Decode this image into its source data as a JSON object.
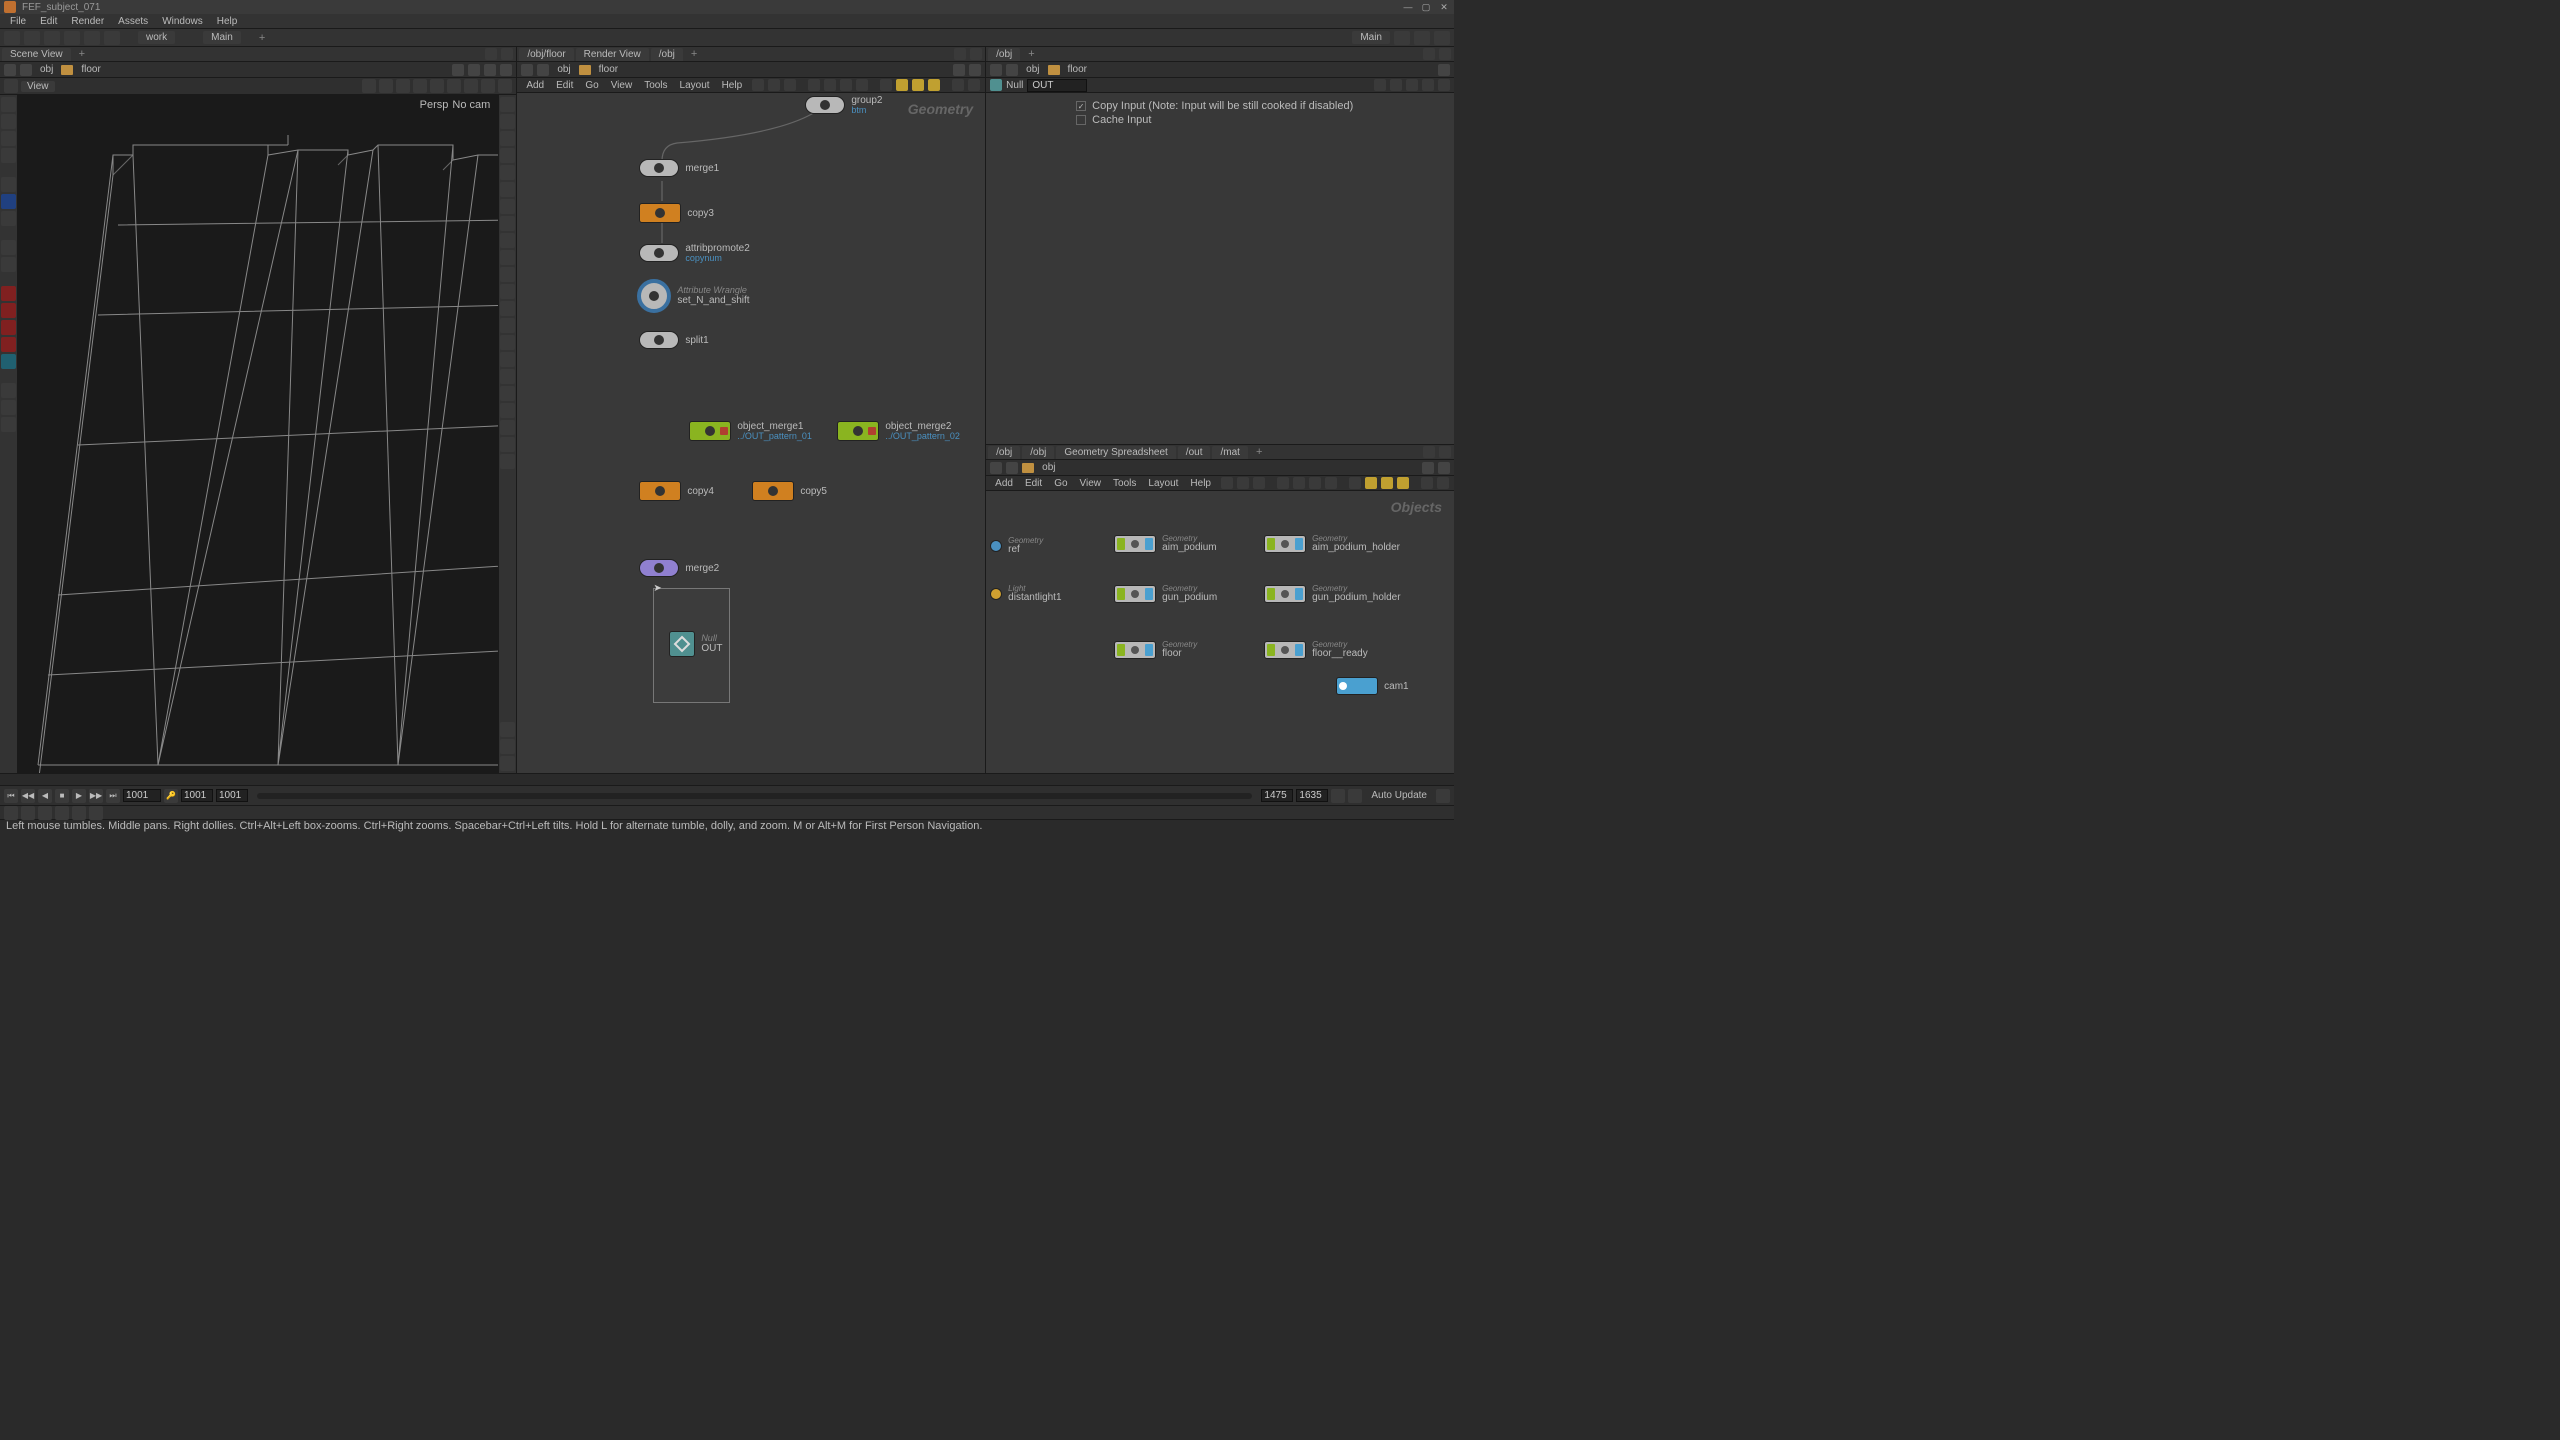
{
  "titlebar": {
    "title": "FEF_subject_071"
  },
  "menubar": [
    "File",
    "Edit",
    "Render",
    "Assets",
    "Windows",
    "Help"
  ],
  "shelf_tabs": [
    "work",
    "Main"
  ],
  "shelf_right": "Main",
  "viewport": {
    "tab": "Scene View",
    "path_prefix": "obj",
    "path": "floor",
    "toolbar_label": "View",
    "persp": "Persp",
    "cam": "No cam"
  },
  "network": {
    "tabs": [
      "/obj/floor",
      "Render View",
      "/obj"
    ],
    "path_prefix": "obj",
    "path": "floor",
    "menus": [
      "Add",
      "Edit",
      "Go",
      "View",
      "Tools",
      "Layout",
      "Help"
    ],
    "context": "Geometry",
    "nodes": {
      "group2": {
        "name": "group2",
        "sub": "btm"
      },
      "merge1": {
        "name": "merge1"
      },
      "copy3": {
        "name": "copy3"
      },
      "attribpromote2": {
        "name": "attribpromote2",
        "sub": "copynum"
      },
      "set_N_and_shift": {
        "name": "set_N_and_shift",
        "type": "Attribute Wrangle"
      },
      "split1": {
        "name": "split1"
      },
      "object_merge1": {
        "name": "object_merge1",
        "sub": "../OUT_pattern_01"
      },
      "object_merge2": {
        "name": "object_merge2",
        "sub": "../OUT_pattern_02"
      },
      "copy4": {
        "name": "copy4"
      },
      "copy5": {
        "name": "copy5"
      },
      "merge2": {
        "name": "merge2"
      },
      "out": {
        "name": "OUT",
        "type": "Null"
      }
    }
  },
  "params": {
    "tab": "/obj",
    "path_prefix": "obj",
    "path": "floor",
    "node_type": "Null",
    "node_name": "OUT",
    "copy_input": "Copy Input (Note: Input will be still cooked if disabled)",
    "cache_input": "Cache Input"
  },
  "objects": {
    "tabs": [
      "/obj",
      "/obj",
      "Geometry Spreadsheet",
      "/out",
      "/mat"
    ],
    "path": "obj",
    "menus": [
      "Add",
      "Edit",
      "Go",
      "View",
      "Tools",
      "Layout",
      "Help"
    ],
    "context": "Objects",
    "items": {
      "ref": {
        "name": "ref",
        "type": "Geometry"
      },
      "distantlight1": {
        "name": "distantlight1",
        "type": "Light"
      },
      "aim_podium": {
        "name": "aim_podium",
        "type": "Geometry"
      },
      "gun_podium": {
        "name": "gun_podium",
        "type": "Geometry"
      },
      "floor": {
        "name": "floor",
        "type": "Geometry"
      },
      "aim_podium_holder": {
        "name": "aim_podium_holder",
        "type": "Geometry"
      },
      "gun_podium_holder": {
        "name": "gun_podium_holder",
        "type": "Geometry"
      },
      "floor_ready": {
        "name": "floor__ready",
        "type": "Geometry"
      },
      "cam1": {
        "name": "cam1",
        "type": "Camera"
      }
    }
  },
  "playbar": {
    "frame": "1001",
    "start": "1001",
    "start2": "1001",
    "end1": "1475",
    "end2": "1635",
    "update": "Auto Update"
  },
  "statusbar": "Left mouse tumbles. Middle pans. Right dollies. Ctrl+Alt+Left box-zooms. Ctrl+Right zooms. Spacebar+Ctrl+Left tilts. Hold L for alternate tumble, dolly, and zoom.    M or Alt+M for First Person Navigation."
}
